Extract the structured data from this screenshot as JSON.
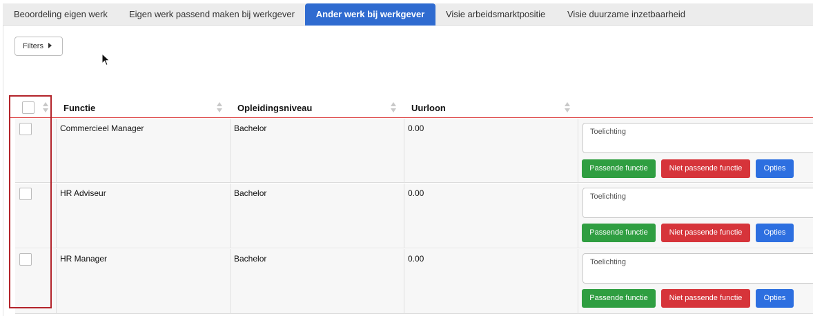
{
  "tabs": [
    {
      "label": "Beoordeling eigen werk",
      "active": false
    },
    {
      "label": "Eigen werk passend maken bij werkgever",
      "active": false
    },
    {
      "label": "Ander werk bij werkgever",
      "active": true
    },
    {
      "label": "Visie arbeidsmarktpositie",
      "active": false
    },
    {
      "label": "Visie duurzame inzetbaarheid",
      "active": false
    }
  ],
  "filters": {
    "label": "Filters"
  },
  "table": {
    "headers": {
      "functie": "Functie",
      "opleidingsniveau": "Opleidingsniveau",
      "uurloon": "Uurloon"
    },
    "rows": [
      {
        "functie": "Commercieel Manager",
        "opleidingsniveau": "Bachelor",
        "uurloon": "0.00",
        "toelichting_placeholder": "Toelichting"
      },
      {
        "functie": "HR Adviseur",
        "opleidingsniveau": "Bachelor",
        "uurloon": "0.00",
        "toelichting_placeholder": "Toelichting"
      },
      {
        "functie": "HR Manager",
        "opleidingsniveau": "Bachelor",
        "uurloon": "0.00",
        "toelichting_placeholder": "Toelichting"
      }
    ],
    "actions": {
      "passend": "Passende functie",
      "niet_passend": "Niet passende functie",
      "opties": "Opties"
    }
  },
  "colors": {
    "tab_active": "#2f6bd0",
    "passend": "#2f9e41",
    "niet_passend": "#d6343a",
    "opties": "#2d6fe0",
    "highlight": "#b3232a"
  },
  "icons": {
    "filters": "caret-right-icon",
    "cursor": "mouse-pointer-icon",
    "sort": "sort-icon"
  }
}
